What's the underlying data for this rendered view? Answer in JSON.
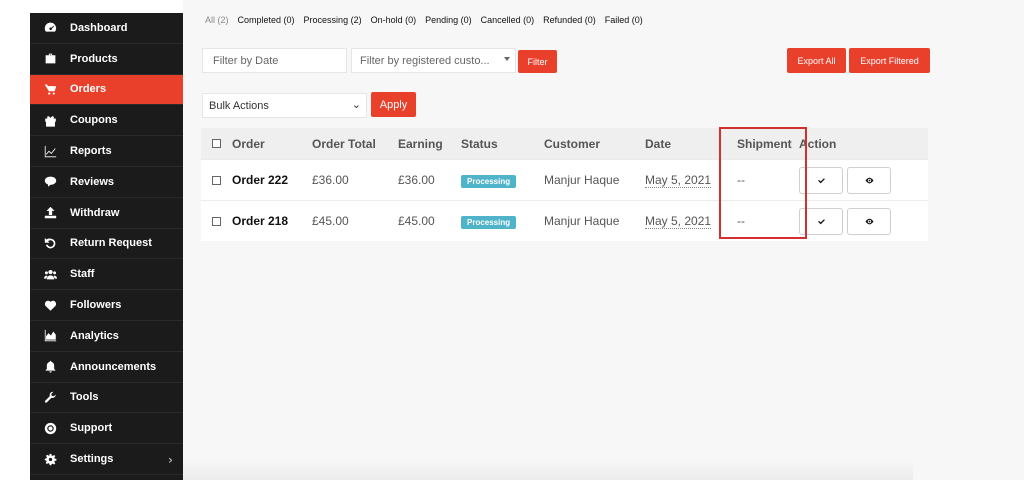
{
  "sidebar": {
    "items": [
      {
        "label": "Dashboard",
        "icon": "dashboard-icon"
      },
      {
        "label": "Products",
        "icon": "briefcase-icon"
      },
      {
        "label": "Orders",
        "icon": "cart-icon",
        "active": true
      },
      {
        "label": "Coupons",
        "icon": "gift-icon"
      },
      {
        "label": "Reports",
        "icon": "line-chart-icon"
      },
      {
        "label": "Reviews",
        "icon": "comments-icon"
      },
      {
        "label": "Withdraw",
        "icon": "upload-icon"
      },
      {
        "label": "Return Request",
        "icon": "undo-icon"
      },
      {
        "label": "Staff",
        "icon": "users-icon"
      },
      {
        "label": "Followers",
        "icon": "heart-icon"
      },
      {
        "label": "Analytics",
        "icon": "area-chart-icon"
      },
      {
        "label": "Announcements",
        "icon": "bell-icon"
      },
      {
        "label": "Tools",
        "icon": "wrench-icon"
      },
      {
        "label": "Support",
        "icon": "lifebuoy-icon"
      },
      {
        "label": "Settings",
        "icon": "gear-icon"
      }
    ],
    "settings_chevron": "›"
  },
  "status_tabs": [
    "All (2)",
    "Completed (0)",
    "Processing (2)",
    "On-hold (0)",
    "Pending (0)",
    "Cancelled (0)",
    "Refunded (0)",
    "Failed (0)"
  ],
  "filters": {
    "date_placeholder": "Filter by Date",
    "customer_placeholder": "Filter by registered custo...",
    "filter_label": "Filter",
    "export_all_label": "Export All",
    "export_filtered_label": "Export Filtered"
  },
  "bulk": {
    "selected": "Bulk Actions",
    "apply_label": "Apply"
  },
  "table": {
    "headers": [
      "Order",
      "Order Total",
      "Earning",
      "Status",
      "Customer",
      "Date",
      "Shipment",
      "Action"
    ],
    "rows": [
      {
        "order": "Order 222",
        "total": "£36.00",
        "earning": "£36.00",
        "status": "Processing",
        "customer": "Manjur Haque",
        "date": "May 5, 2021",
        "shipment": "--"
      },
      {
        "order": "Order 218",
        "total": "£45.00",
        "earning": "£45.00",
        "status": "Processing",
        "customer": "Manjur Haque",
        "date": "May 5, 2021",
        "shipment": "--"
      }
    ]
  },
  "colors": {
    "accent": "#e9402c",
    "sidebar_bg": "#1b1b1b",
    "badge": "#4fb3c9",
    "highlight": "#d32f2f"
  }
}
